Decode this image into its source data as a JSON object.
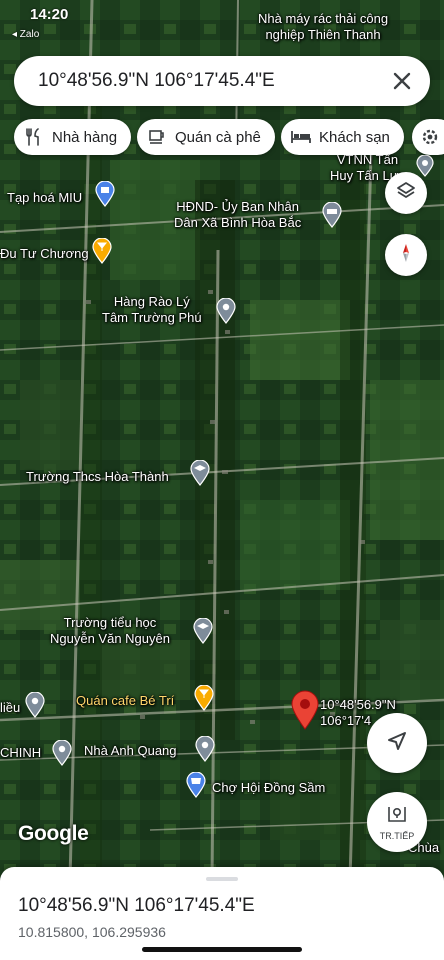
{
  "status": {
    "time": "14:20",
    "back_label": "◂ Zalo"
  },
  "search": {
    "value": "10°48'56.9\"N 106°17'45.4\"E"
  },
  "chips": [
    {
      "label": "Nhà hàng",
      "icon": "fork-knife-icon"
    },
    {
      "label": "Quán cà phê",
      "icon": "coffee-cup-icon"
    },
    {
      "label": "Khách sạn",
      "icon": "bed-icon"
    }
  ],
  "map": {
    "labels": {
      "factory_line1": "Nhà máy rác thải công",
      "factory_line2": "nghiệp Thiên Thanh",
      "vtnn_line1": "VTNN Tấn",
      "vtnn_line2": "Huy Tấn Lực",
      "taphoa": "Tạp hoá MIU",
      "hdnd_line1": "HĐND- Ủy Ban Nhân",
      "hdnd_line2": "Dân Xã Bình Hòa Bắc",
      "tuchuong": "Đu Tư Chương",
      "hangrao_line1": "Hàng Rào Lý",
      "hangrao_line2": "Tâm Trường Phú",
      "thcs": "Trường Thcs Hòa Thành",
      "tieuhoc_line1": "Trường tiểu học",
      "tieuhoc_line2": "Nguyễn Văn Nguyên",
      "cafe": "Quán cafe Bé Trí",
      "lieu": "liều",
      "chinh": "CHINH",
      "anhquang": "Nhà Anh Quang",
      "cho": "Chợ Hội Đồng Sầm",
      "pin_line1": "10°48'56.9\"N",
      "pin_line2": "106°17'4",
      "chua": "Chùa"
    }
  },
  "buttons": {
    "next_label": "TR.TIẾP"
  },
  "attribution": "Google",
  "sheet": {
    "title": "10°48'56.9\"N 106°17'45.4\"E",
    "decimal": "10.815800, 106.295936"
  },
  "colors": {
    "accent": "#1a73e8",
    "pin": "#ea4335",
    "poi_orange": "#f9ab00",
    "poi_gray": "#7e8c9a",
    "poi_blue": "#4a82e8"
  }
}
